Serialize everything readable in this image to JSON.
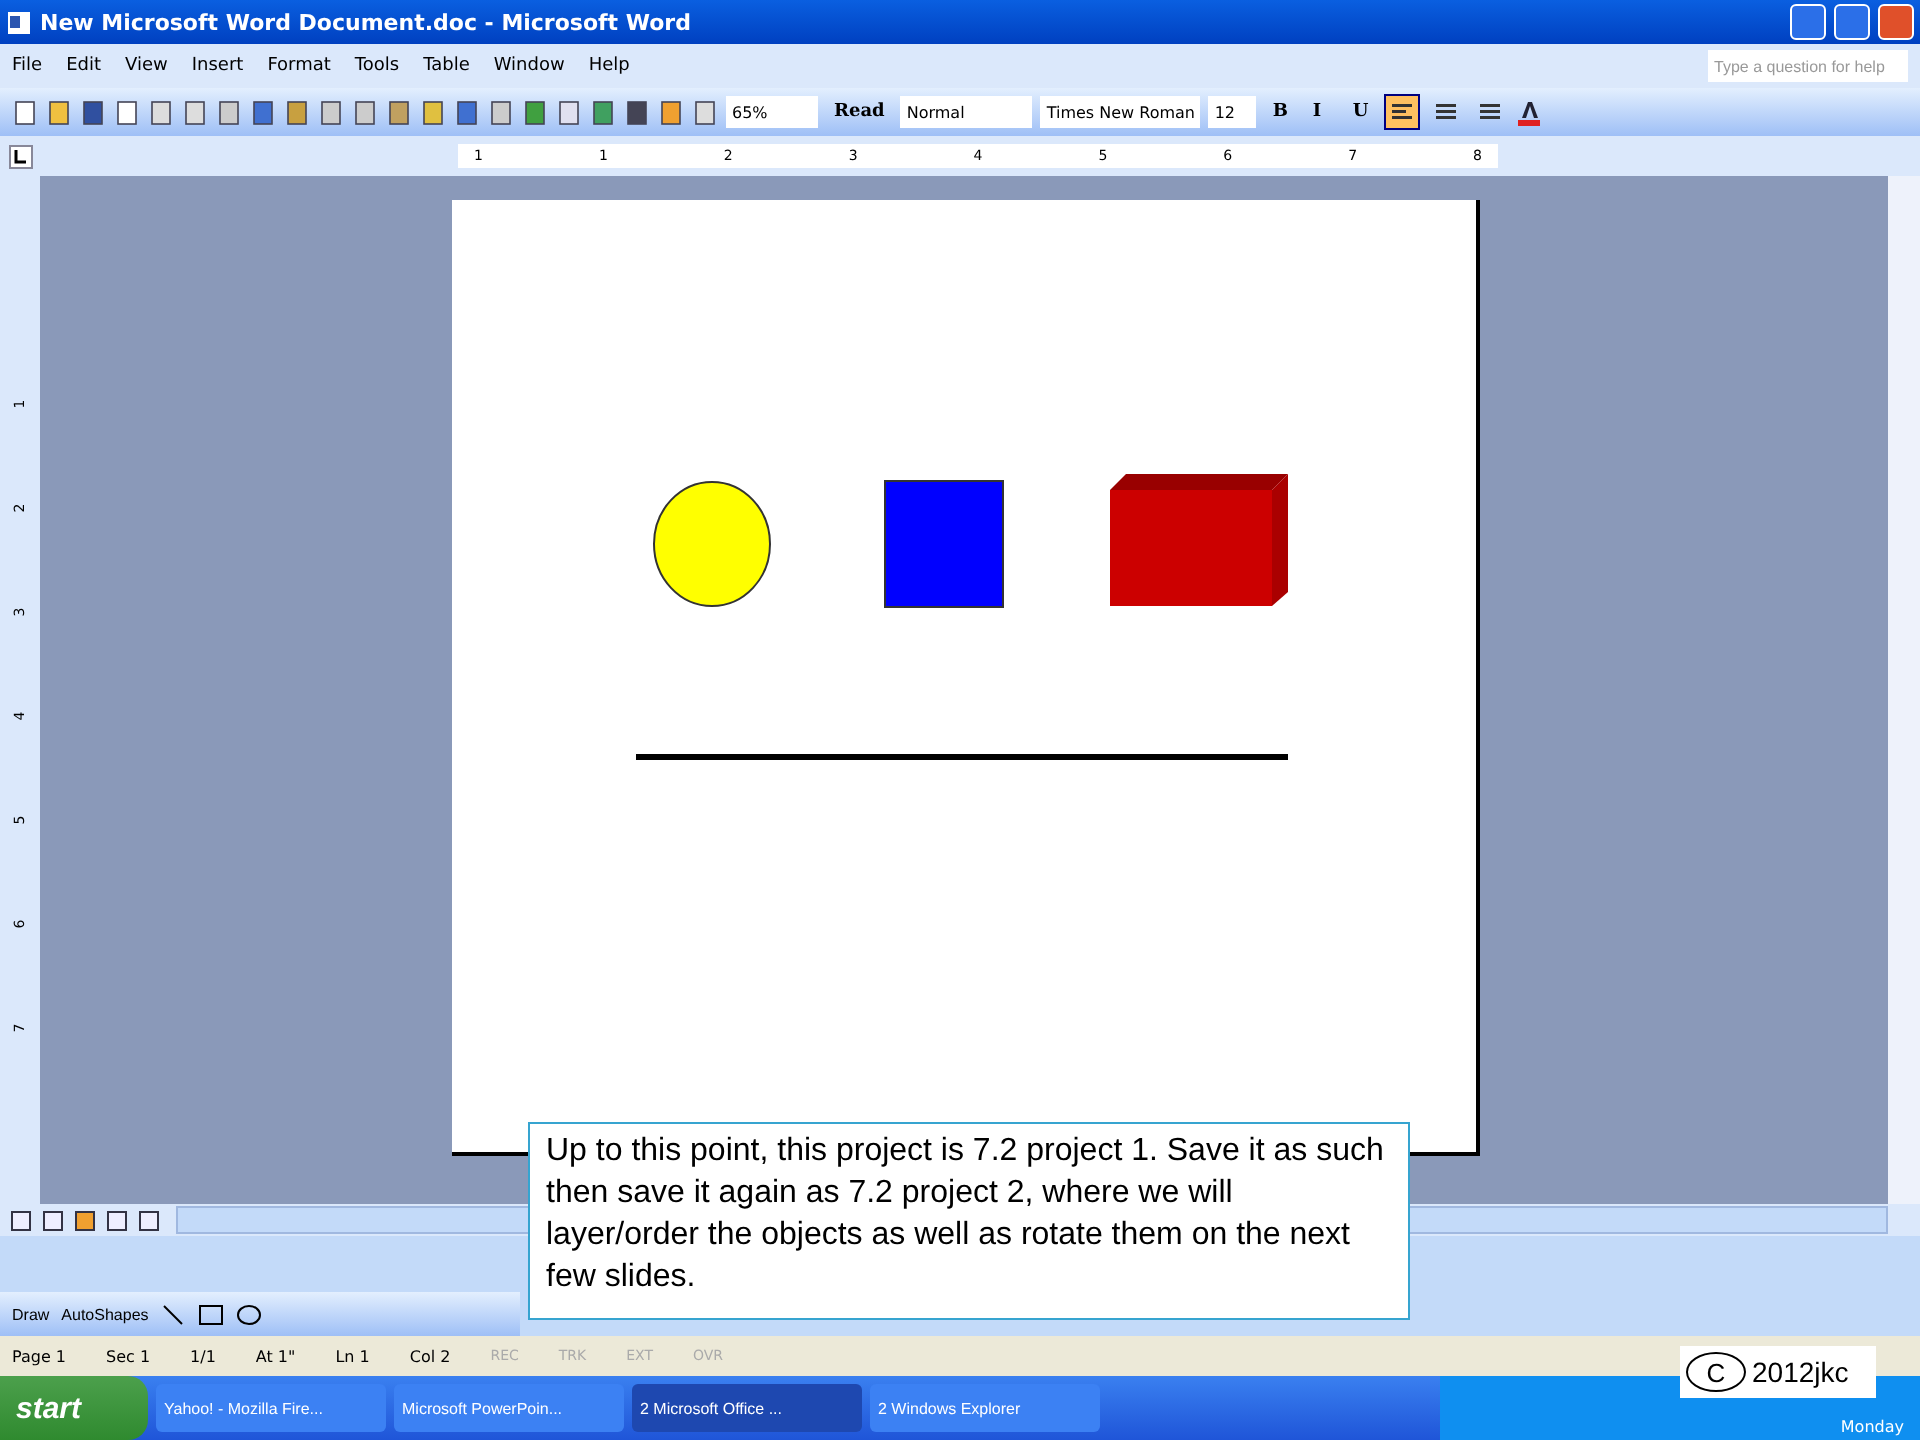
{
  "window": {
    "title": "New Microsoft Word Document.doc - Microsoft Word"
  },
  "menu": [
    "File",
    "Edit",
    "View",
    "Insert",
    "Format",
    "Tools",
    "Table",
    "Window",
    "Help"
  ],
  "help_box": {
    "placeholder": "Type a question for help"
  },
  "toolbar": {
    "zoom": "65%",
    "read": "Read",
    "style": "Normal",
    "font": "Times New Roman",
    "size": "12"
  },
  "format_buttons": [
    "B",
    "I",
    "U"
  ],
  "alignment": [
    {
      "selected": true
    },
    {
      "selected": false
    },
    {
      "selected": false
    }
  ],
  "ruler_numbers": [
    "1",
    "1",
    "2",
    "3",
    "4",
    "5",
    "6",
    "7",
    "8"
  ],
  "vertical_ruler": [
    "1",
    "2",
    "3",
    "4",
    "5",
    "6",
    "7"
  ],
  "shapes": [
    {
      "kind": "circle",
      "color": "#ffff00"
    },
    {
      "kind": "square",
      "color": "#0000ff"
    },
    {
      "kind": "box",
      "color": "#cc0000"
    },
    {
      "kind": "line",
      "color": "#000000"
    }
  ],
  "callout": "Up to this point, this project is 7.2 project 1. Save it as such then save it again as 7.2 project 2, where we will layer/order the objects as well as rotate them on the next few slides.",
  "draw_toolbar": {
    "draw": "Draw",
    "autoshapes": "AutoShapes"
  },
  "status_bar": {
    "fields": [
      "Page 1",
      "Sec 1",
      "1/1",
      "At 1\"",
      "Ln 1",
      "Col 2"
    ],
    "modes": [
      {
        "label": "REC",
        "on": false
      },
      {
        "label": "TRK",
        "on": false
      },
      {
        "label": "EXT",
        "on": false
      },
      {
        "label": "OVR",
        "on": false
      }
    ]
  },
  "taskbar": {
    "start": "start",
    "tasks": [
      {
        "label": "Yahoo! - Mozilla Fire...",
        "selected": false
      },
      {
        "label": "Microsoft PowerPoin...",
        "selected": false
      },
      {
        "label": "2 Microsoft Office ...",
        "selected": true
      },
      {
        "label": "2 Windows Explorer",
        "selected": false
      }
    ],
    "clock": "Monday"
  },
  "copyright": {
    "mark": "C",
    "text": "2012jkc"
  }
}
